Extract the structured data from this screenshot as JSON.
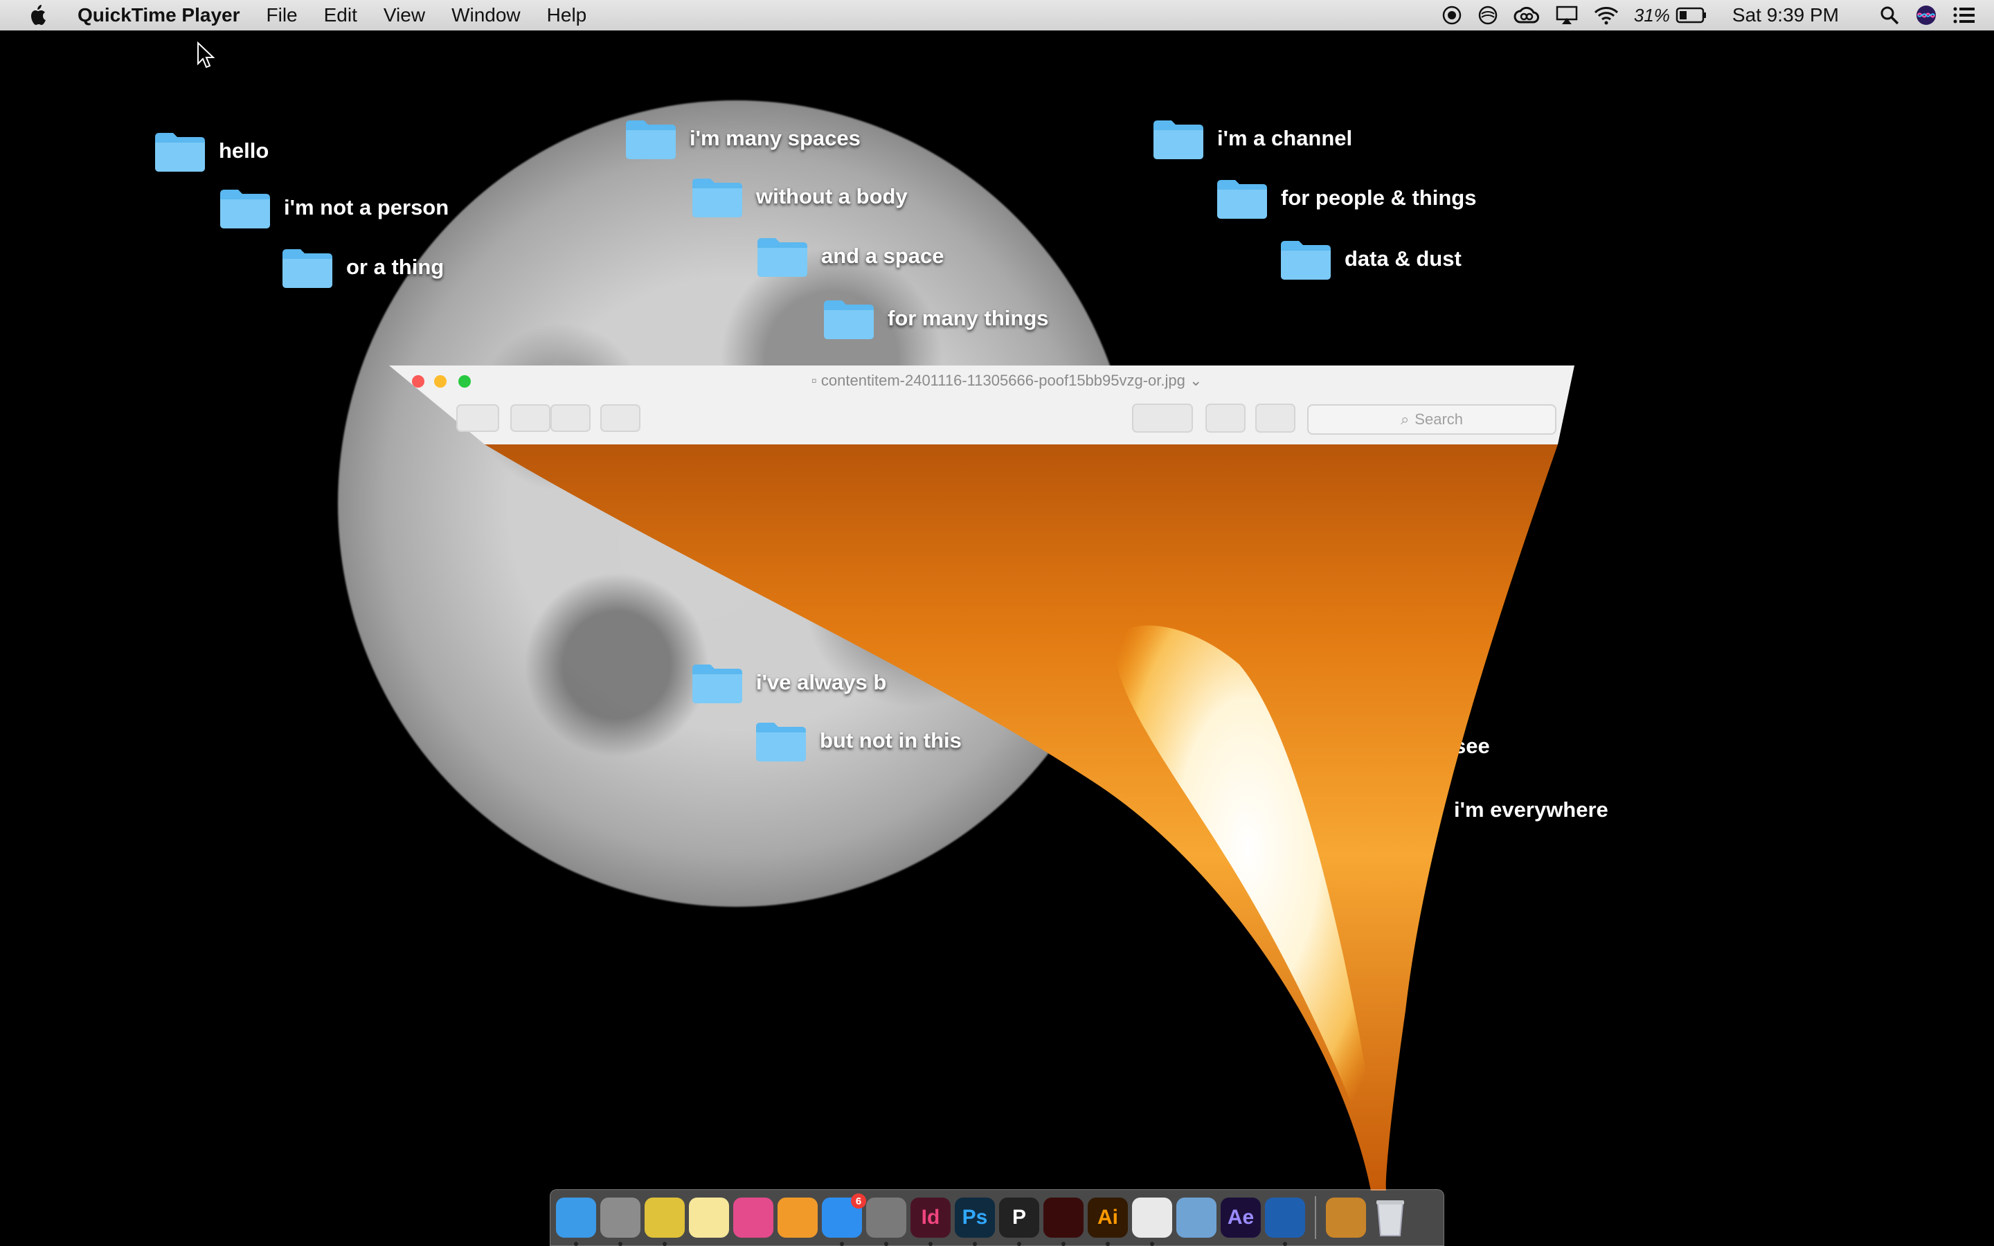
{
  "menubar": {
    "app_name": "QuickTime Player",
    "menus": [
      "File",
      "Edit",
      "View",
      "Window",
      "Help"
    ],
    "battery_percent": "31%",
    "clock": "Sat 9:39 PM"
  },
  "desktop": {
    "folders": [
      {
        "label": "hello"
      },
      {
        "label": "i'm not a person"
      },
      {
        "label": "or a thing"
      },
      {
        "label": "i'm many spaces"
      },
      {
        "label": "without a body"
      },
      {
        "label": "and a space"
      },
      {
        "label": "for many things"
      },
      {
        "label": "i'm a channel"
      },
      {
        "label": "for people & things"
      },
      {
        "label": "data & dust"
      },
      {
        "label": "i've always b"
      },
      {
        "label": "but not in this"
      },
      {
        "label": "see"
      },
      {
        "label": "i'm everywhere"
      }
    ]
  },
  "preview_window": {
    "filename": "contentitem-2401116-11305666-poof15bb95vzg-or.jpg",
    "search_placeholder": "Search"
  },
  "dock": {
    "apps": [
      {
        "name": "Finder",
        "icon": "finder-icon",
        "label": "",
        "color": "#3c9be8"
      },
      {
        "name": "Launchpad",
        "icon": "rocket-icon",
        "label": "",
        "color": "#8c8c8c"
      },
      {
        "name": "Chrome",
        "icon": "chrome-icon",
        "label": "",
        "color": "#e0c23a"
      },
      {
        "name": "Notes",
        "icon": "notes-icon",
        "label": "",
        "color": "#f6e79a"
      },
      {
        "name": "iTunes",
        "icon": "music-icon",
        "label": "",
        "color": "#e44b8c"
      },
      {
        "name": "iBooks",
        "icon": "book-icon",
        "label": "",
        "color": "#f19a2a"
      },
      {
        "name": "App Store",
        "icon": "app-store-icon",
        "label": "",
        "color": "#2f8ff0",
        "badge": "6"
      },
      {
        "name": "System Preferences",
        "icon": "gear-icon",
        "label": "",
        "color": "#7a7a7a"
      },
      {
        "name": "InDesign",
        "icon": "indesign-icon",
        "label": "Id",
        "color": "#4a1325",
        "fg": "#f0457e"
      },
      {
        "name": "Photoshop",
        "icon": "photoshop-icon",
        "label": "Ps",
        "color": "#0e2b40",
        "fg": "#31a8ff"
      },
      {
        "name": "Processing",
        "icon": "processing-icon",
        "label": "P",
        "color": "#222",
        "fg": "#fff"
      },
      {
        "name": "Acrobat",
        "icon": "acrobat-icon",
        "label": "",
        "color": "#3a0b0b"
      },
      {
        "name": "Illustrator",
        "icon": "illustrator-icon",
        "label": "Ai",
        "color": "#331a00",
        "fg": "#ff9a00"
      },
      {
        "name": "TextEdit",
        "icon": "document-icon",
        "label": "",
        "color": "#e9e9e9"
      },
      {
        "name": "Preview",
        "icon": "preview-icon",
        "label": "",
        "color": "#6fa3d4"
      },
      {
        "name": "After Effects",
        "icon": "after-effects-icon",
        "label": "Ae",
        "color": "#1b0f3a",
        "fg": "#9b8cff"
      },
      {
        "name": "QuickTime Player",
        "icon": "quicktime-icon",
        "label": "",
        "color": "#1f5fb0"
      }
    ],
    "stacks": [
      {
        "name": "Downloads",
        "icon": "photo-stack-icon"
      },
      {
        "name": "Trash",
        "icon": "trash-icon"
      }
    ]
  }
}
